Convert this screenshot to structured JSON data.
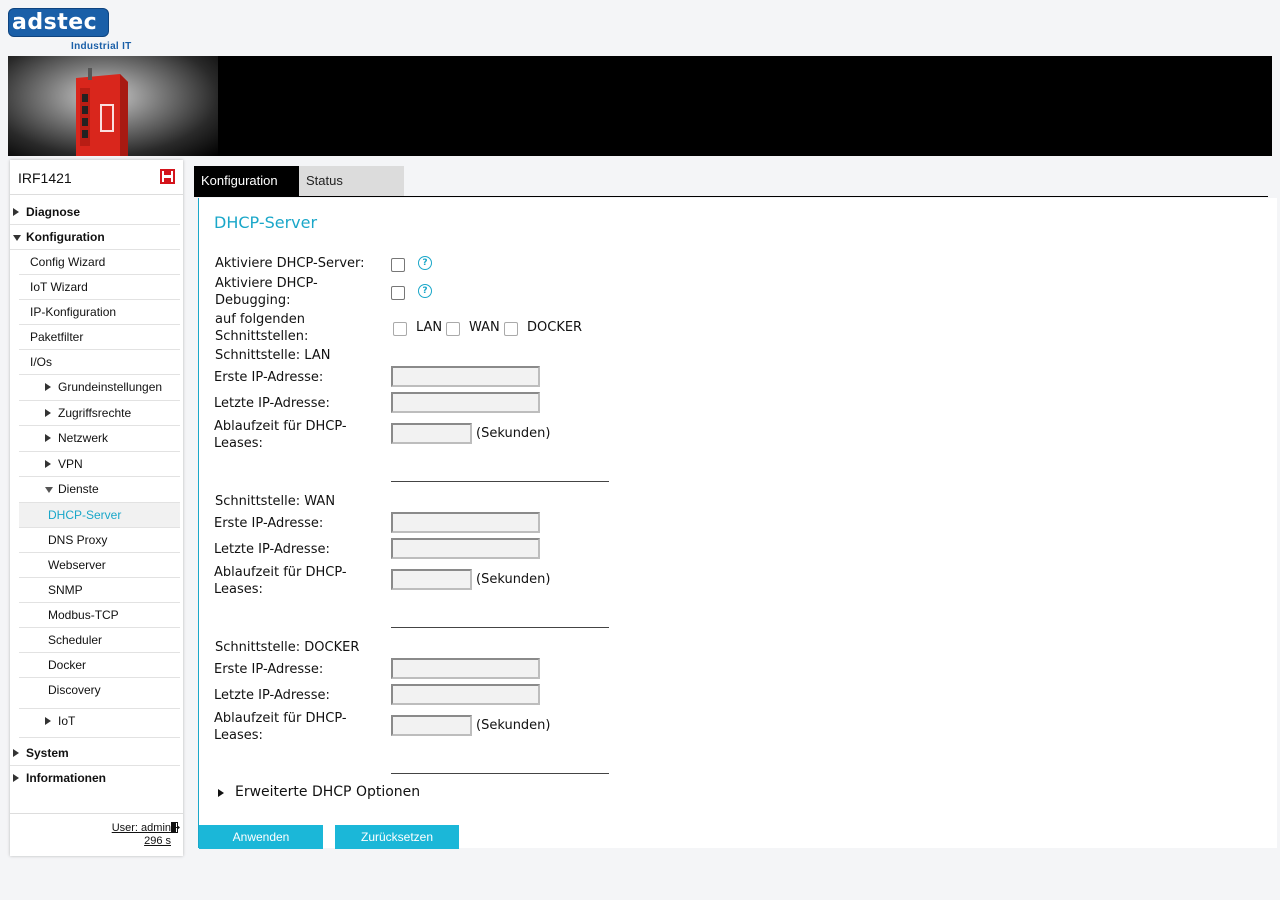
{
  "header": {
    "logo_text": "adstec",
    "logo_subtitle": "Industrial IT"
  },
  "sidebar": {
    "device_name": "IRF1421",
    "items": [
      {
        "label": "Diagnose"
      },
      {
        "label": "Konfiguration"
      },
      {
        "label": "Config Wizard"
      },
      {
        "label": "IoT Wizard"
      },
      {
        "label": "IP-Konfiguration"
      },
      {
        "label": "Paketfilter"
      },
      {
        "label": "I/Os"
      },
      {
        "label": "Grundeinstellungen"
      },
      {
        "label": "Zugriffsrechte"
      },
      {
        "label": "Netzwerk"
      },
      {
        "label": "VPN"
      },
      {
        "label": "Dienste"
      },
      {
        "label": "DHCP-Server"
      },
      {
        "label": "DNS Proxy"
      },
      {
        "label": "Webserver"
      },
      {
        "label": "SNMP"
      },
      {
        "label": "Modbus-TCP"
      },
      {
        "label": "Scheduler"
      },
      {
        "label": "Docker"
      },
      {
        "label": "Discovery"
      },
      {
        "label": "IoT"
      },
      {
        "label": "System"
      },
      {
        "label": "Informationen"
      }
    ],
    "user": "User: admin",
    "session_time": "296 s"
  },
  "tabs": [
    {
      "label": "Konfiguration",
      "active": true
    },
    {
      "label": "Status",
      "active": false
    }
  ],
  "main": {
    "title": "DHCP-Server",
    "enable_label": "Aktiviere DHCP-Server:",
    "debug_label": "Aktiviere DHCP-Debugging:",
    "debug_label_l1": "Aktiviere DHCP-",
    "debug_label_l2": "Debugging:",
    "interfaces_label_l1": "auf folgenden",
    "interfaces_label_l2": "Schnittstellen:",
    "interfaces": [
      "LAN",
      "WAN",
      "DOCKER"
    ],
    "sections": [
      {
        "title": "Schnittstelle: LAN",
        "first_ip_label": "Erste IP-Adresse:",
        "first_ip": "",
        "last_ip_label": "Letzte IP-Adresse:",
        "last_ip": "",
        "lease_label_l1": "Ablaufzeit für DHCP-",
        "lease_label_l2": "Leases:",
        "lease": "",
        "unit": "(Sekunden)"
      },
      {
        "title": "Schnittstelle: WAN",
        "first_ip_label": "Erste IP-Adresse:",
        "first_ip": "",
        "last_ip_label": "Letzte IP-Adresse:",
        "last_ip": "",
        "lease_label_l1": "Ablaufzeit für DHCP-",
        "lease_label_l2": "Leases:",
        "lease": "",
        "unit": "(Sekunden)"
      },
      {
        "title": "Schnittstelle: DOCKER",
        "first_ip_label": "Erste IP-Adresse:",
        "first_ip": "",
        "last_ip_label": "Letzte IP-Adresse:",
        "last_ip": "",
        "lease_label_l1": "Ablaufzeit für DHCP-",
        "lease_label_l2": "Leases:",
        "lease": "",
        "unit": "(Sekunden)"
      }
    ],
    "advanced_label": "Erweiterte DHCP Optionen"
  },
  "buttons": {
    "apply": "Anwenden",
    "reset": "Zurücksetzen"
  },
  "colors": {
    "accent": "#1aa7c9",
    "button": "#1bb7d8",
    "brand_blue": "#1a5fa8",
    "banner": "#000000"
  }
}
